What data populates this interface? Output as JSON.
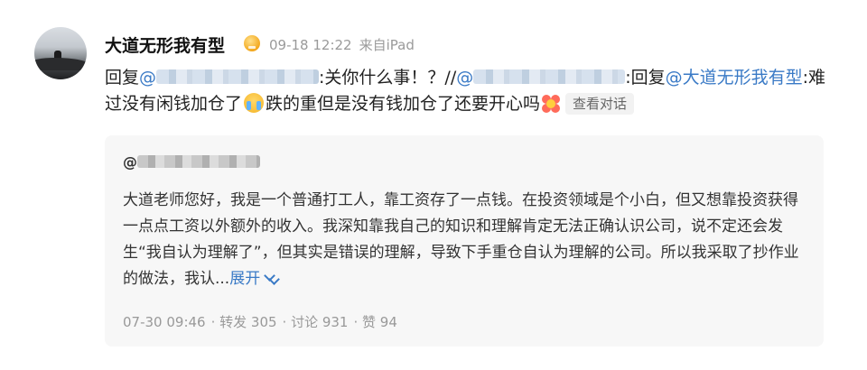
{
  "post": {
    "author": "大道无形我有型",
    "date": "09-18 12:22",
    "source": "来自iPad",
    "reply_prefix": "回复",
    "at_sign": "@",
    "text1": ":关你什么事！？//",
    "reply_mid": ":回复",
    "mention_author": "@大道无形我有型",
    "text2": ":难过没有闲钱加仓了",
    "text3": "跌的重但是没有钱加仓了还要开心吗",
    "view_conversation": "查看对话",
    "emoji_1": "crying-face-icon",
    "emoji_2": "flower-icon"
  },
  "quoted": {
    "at_sign": "@",
    "body": "大道老师您好，我是一个普通打工人，靠工资存了一点钱。在投资领域是个小白，但又想靠投资获得一点点工资以外额外的收入。我深知靠我自己的知识和理解肯定无法正确认识公司，说不定还会发生“我自认为理解了”，但其实是错误的理解，导致下手重仓自认为理解的公司。所以我采取了抄作业的做法，我认...",
    "expand": "展开",
    "date": "07-30 09:46",
    "repost": "· 转发 305",
    "comment": "· 讨论 931",
    "like": "· 赞 94"
  },
  "colors": {
    "link": "#3a7ac6",
    "meta": "#9a9a9a",
    "card_bg": "#f7f7f7"
  }
}
